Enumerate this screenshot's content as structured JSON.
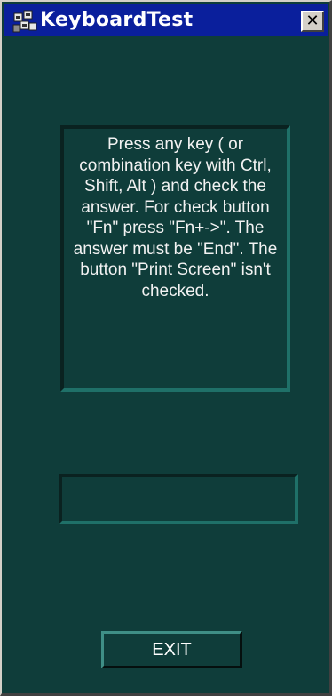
{
  "window": {
    "title": "KeyboardTest",
    "close_label": "✕",
    "background_color": "#0f3d3a",
    "titlebar_color": "#0a1f9c"
  },
  "instructions": {
    "text": "Press any key ( or combination key with Ctrl, Shift, Alt ) and check the answer. For check button \"Fn\" press  \"Fn+->\". The answer must be \"End\". The button \"Print Screen\" isn't checked."
  },
  "answer": {
    "value": ""
  },
  "exit_button": {
    "label": "EXIT"
  },
  "icons": {
    "app": "keyboard-test-app-icon",
    "close": "close-icon"
  }
}
